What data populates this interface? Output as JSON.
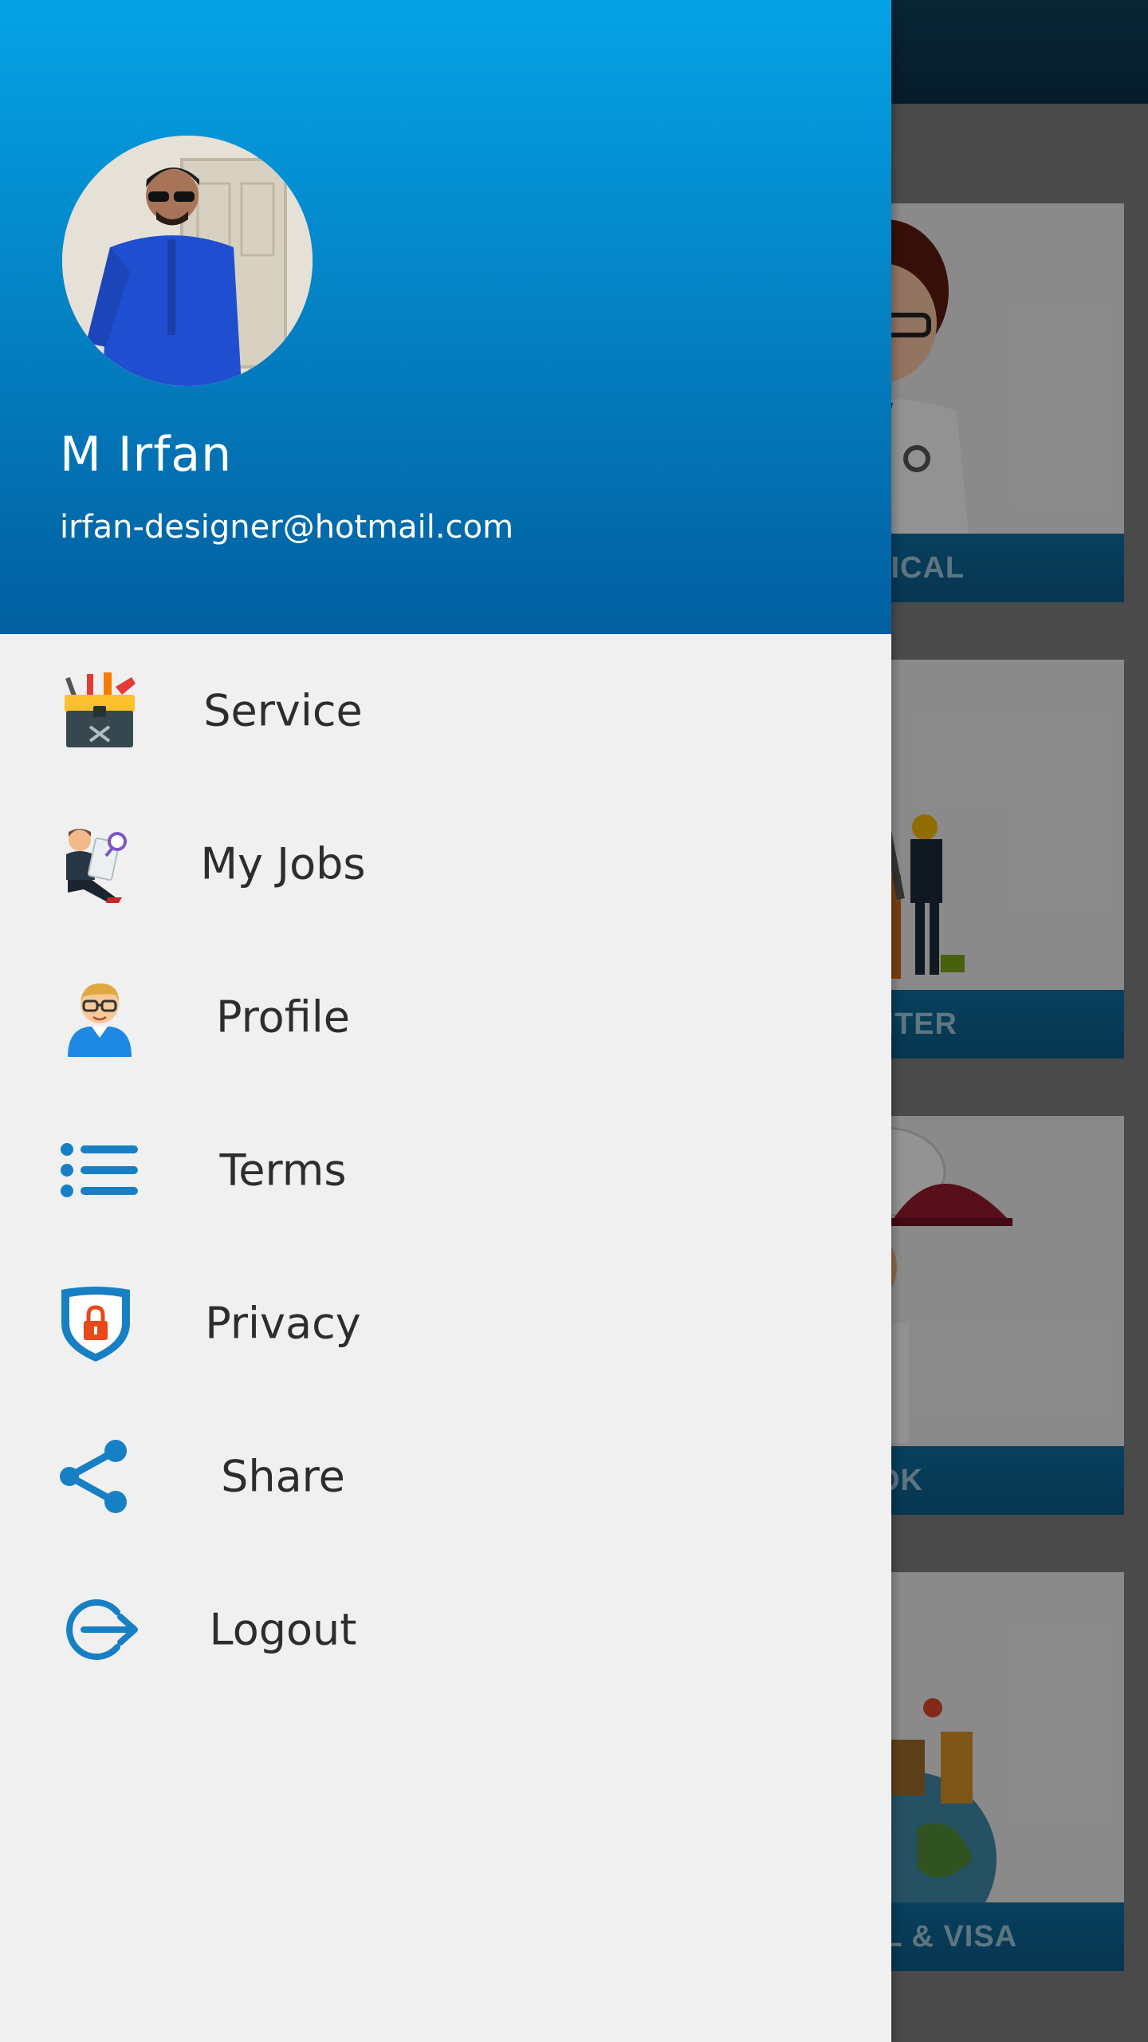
{
  "user": {
    "name": "M Irfan",
    "email": "irfan-designer@hotmail.com"
  },
  "menu": [
    {
      "label": "Service",
      "icon": "toolbox-icon"
    },
    {
      "label": "My Jobs",
      "icon": "job-seeker-icon"
    },
    {
      "label": "Profile",
      "icon": "user-profile-icon"
    },
    {
      "label": "Terms",
      "icon": "list-icon"
    },
    {
      "label": "Privacy",
      "icon": "shield-lock-icon"
    },
    {
      "label": "Share",
      "icon": "share-icon"
    },
    {
      "label": "Logout",
      "icon": "logout-icon"
    }
  ],
  "background_categories": [
    {
      "label": "MEDICAL"
    },
    {
      "label": "PAINTER"
    },
    {
      "label": "COOK"
    },
    {
      "label": "AVEL & VISA"
    }
  ],
  "colors": {
    "header_top": "#05a3e6",
    "header_bottom": "#025fa0",
    "accent_blue": "#1780c4",
    "drawer_bg": "#f0f0f1",
    "text_dark": "#2d2d2d"
  }
}
